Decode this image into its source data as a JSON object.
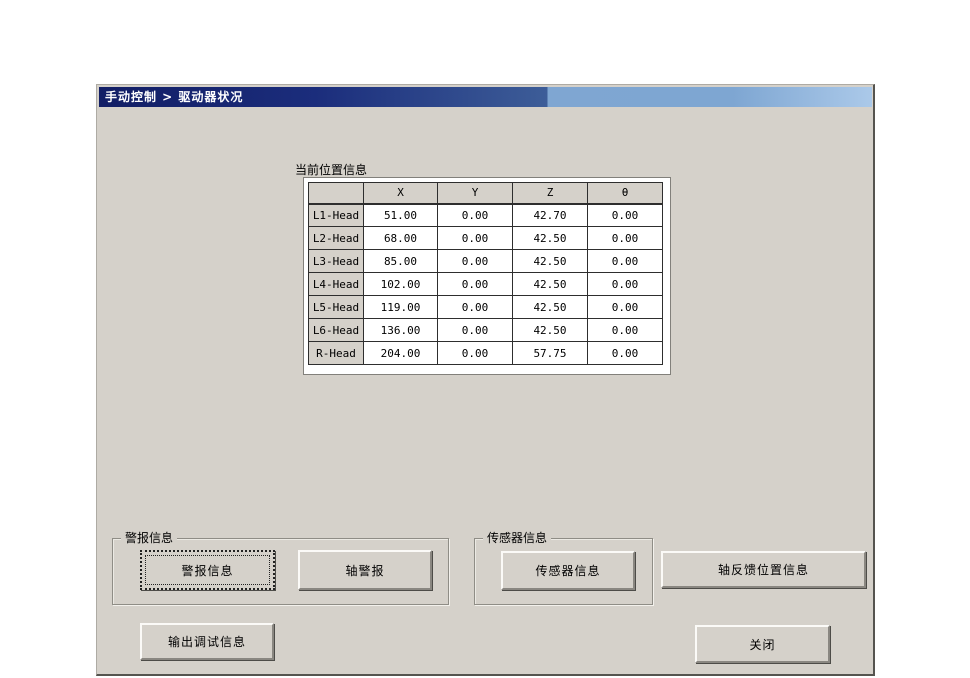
{
  "window": {
    "title": "手动控制 > 驱动器状况"
  },
  "position_table": {
    "label": "当前位置信息",
    "columns": [
      "",
      "X",
      "Y",
      "Z",
      "θ"
    ],
    "rows": [
      [
        "L1-Head",
        "51.00",
        "0.00",
        "42.70",
        "0.00"
      ],
      [
        "L2-Head",
        "68.00",
        "0.00",
        "42.50",
        "0.00"
      ],
      [
        "L3-Head",
        "85.00",
        "0.00",
        "42.50",
        "0.00"
      ],
      [
        "L4-Head",
        "102.00",
        "0.00",
        "42.50",
        "0.00"
      ],
      [
        "L5-Head",
        "119.00",
        "0.00",
        "42.50",
        "0.00"
      ],
      [
        "L6-Head",
        "136.00",
        "0.00",
        "42.50",
        "0.00"
      ],
      [
        "R-Head",
        "204.00",
        "0.00",
        "57.75",
        "0.00"
      ]
    ]
  },
  "alarm_group": {
    "label": "警报信息",
    "alarm_info_button": "警报信息",
    "axis_alarm_button": "轴警报"
  },
  "sensor_group": {
    "label": "传感器信息",
    "sensor_info_button": "传感器信息"
  },
  "buttons": {
    "axis_feedback": "轴反馈位置信息",
    "output_debug": "输出调试信息",
    "close": "关闭"
  },
  "colors": {
    "panel_bg": "#d5d1ca",
    "titlebar_gradient_start": "#121e65",
    "titlebar_gradient_end": "#abc9e9",
    "titlebar_text": "#ffffff",
    "grid_line": "#2e2e2e",
    "cell_bg": "#ffffff"
  }
}
